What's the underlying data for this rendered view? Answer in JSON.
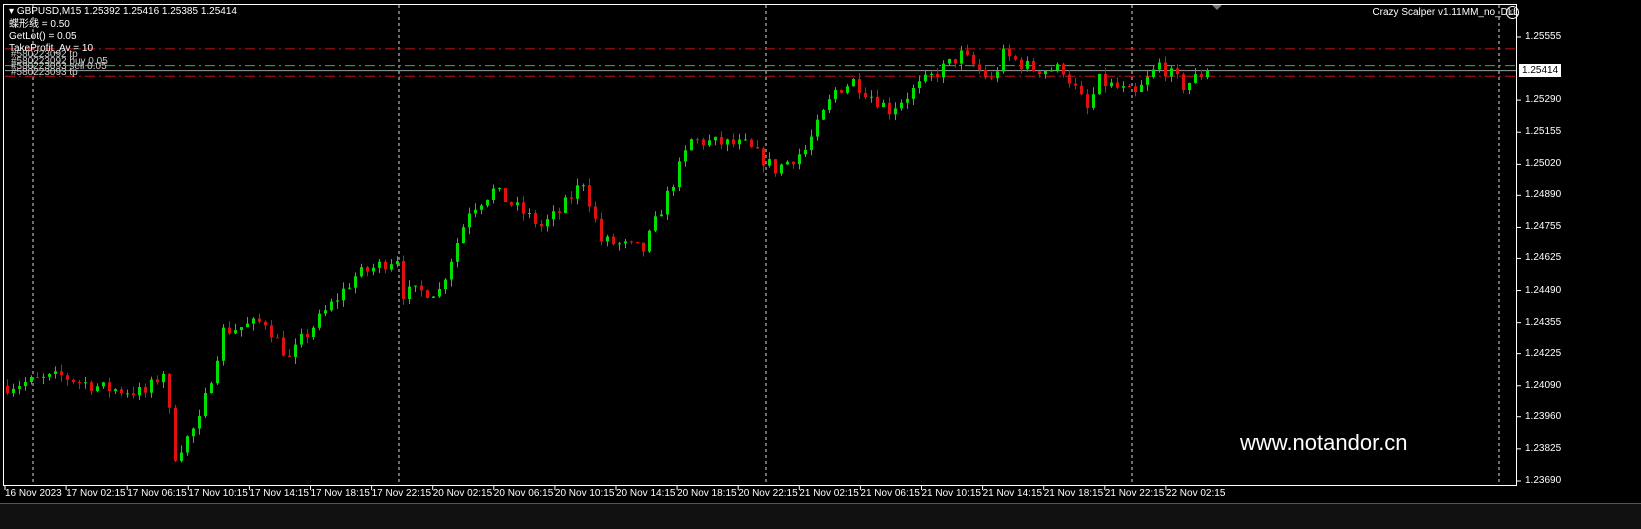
{
  "header": {
    "symbol_line": "GBPUSD,M15  1.25392 1.25416 1.25385 1.25414",
    "info_lines": [
      "蝶形线 = 0.50",
      "GetLot() = 0.05",
      "TakeProfit_Av = 10"
    ],
    "order_labels": [
      "#580223092 tp",
      "#580223092 buy 0.05",
      "#580223093 sell 0.05",
      "#580223093 tp"
    ],
    "expert_name": "Crazy Scalper v1.11MM_no_DLL",
    "expert_icon": "smiley-icon"
  },
  "current_price": "1.25414",
  "watermark": "www.notandor.cn",
  "colors": {
    "bull": "#00e000",
    "bear": "#e01010",
    "tp_line": "#c81414",
    "order_line": "#3cb43c",
    "bid_line": "#a0a0a0"
  },
  "chart_data": {
    "type": "candlestick",
    "symbol": "GBPUSD",
    "timeframe": "M15",
    "y_ticks": [
      "1.25555",
      "1.25290",
      "1.25155",
      "1.25020",
      "1.24890",
      "1.24755",
      "1.24625",
      "1.24490",
      "1.24355",
      "1.24225",
      "1.24090",
      "1.23960",
      "1.23825",
      "1.23690"
    ],
    "ylim": [
      1.2369,
      1.25555
    ],
    "x_ticks": [
      "16 Nov 2023",
      "17 Nov 02:15",
      "17 Nov 06:15",
      "17 Nov 10:15",
      "17 Nov 14:15",
      "17 Nov 18:15",
      "17 Nov 22:15",
      "20 Nov 02:15",
      "20 Nov 06:15",
      "20 Nov 10:15",
      "20 Nov 14:15",
      "20 Nov 18:15",
      "20 Nov 22:15",
      "21 Nov 02:15",
      "21 Nov 06:15",
      "21 Nov 10:15",
      "21 Nov 14:15",
      "21 Nov 18:15",
      "21 Nov 22:15",
      "22 Nov 02:15"
    ],
    "candle_count": 201,
    "close_trend": [
      [
        0,
        1.2409
      ],
      [
        9,
        1.2413
      ],
      [
        16,
        1.2408
      ],
      [
        23,
        1.2406
      ],
      [
        26,
        1.2415
      ],
      [
        28,
        1.238
      ],
      [
        32,
        1.2394
      ],
      [
        36,
        1.2432
      ],
      [
        43,
        1.2436
      ],
      [
        47,
        1.242
      ],
      [
        49,
        1.2428
      ],
      [
        58,
        1.2455
      ],
      [
        65,
        1.2463
      ],
      [
        66,
        1.2448
      ],
      [
        72,
        1.2449
      ],
      [
        77,
        1.2483
      ],
      [
        81,
        1.2491
      ],
      [
        89,
        1.2476
      ],
      [
        92,
        1.2482
      ],
      [
        96,
        1.2495
      ],
      [
        99,
        1.247
      ],
      [
        106,
        1.2466
      ],
      [
        114,
        1.2512
      ],
      [
        123,
        1.251
      ],
      [
        128,
        1.25
      ],
      [
        133,
        1.2508
      ],
      [
        138,
        1.2533
      ],
      [
        141,
        1.2537
      ],
      [
        147,
        1.2525
      ],
      [
        152,
        1.2535
      ],
      [
        159,
        1.2548
      ],
      [
        164,
        1.2537
      ],
      [
        166,
        1.2548
      ],
      [
        171,
        1.2542
      ],
      [
        176,
        1.2542
      ],
      [
        180,
        1.2525
      ],
      [
        182,
        1.2537
      ],
      [
        188,
        1.2531
      ],
      [
        192,
        1.2544
      ],
      [
        196,
        1.2535
      ],
      [
        200,
        1.25414
      ]
    ],
    "levels": {
      "tp_upper": 1.25505,
      "buy_sell": 1.25435,
      "bid": 1.25414,
      "tp_lower": 1.2539
    }
  }
}
